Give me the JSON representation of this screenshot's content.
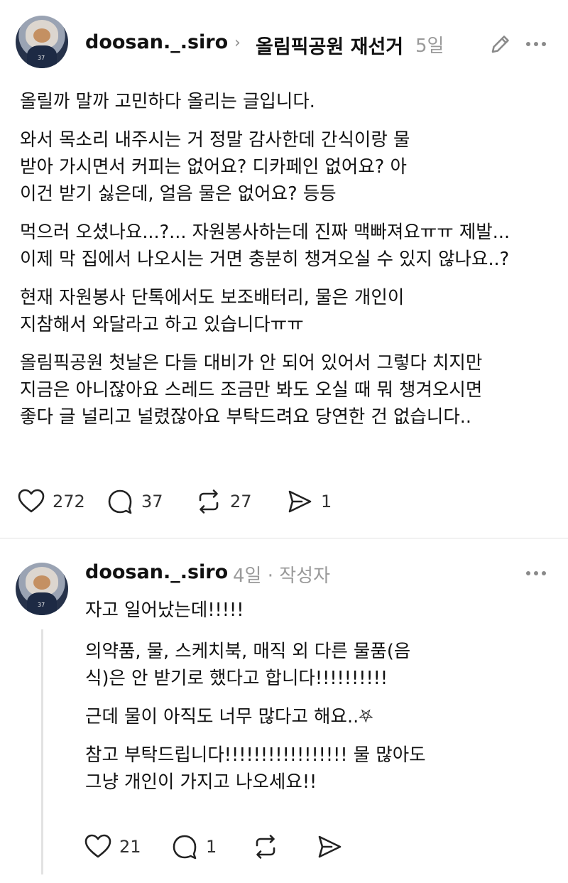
{
  "post": {
    "username": "doosan._.siro",
    "topic": "올림픽공원 재선거",
    "time": "5일",
    "paragraphs": [
      [
        "올릴까 말까 고민하다 올리는 글입니다."
      ],
      [
        "와서 목소리 내주시는 거 정말 감사한데 간식이랑 물",
        "받아 가시면서 커피는 없어요? 디카페인 없어요? 아",
        "이건 받기 싫은데, 얼음 물은 없어요? 등등"
      ],
      [
        "먹으러 오셨나요...?... 자원봉사하는데 진짜 맥빠져요ㅠㅠ 제발...",
        "이제 막 집에서 나오시는 거면 충분히 챙겨오실 수 있지 않나요..?"
      ],
      [
        "현재 자원봉사 단톡에서도 보조배터리, 물은 개인이",
        "지참해서 와달라고 하고 있습니다ㅠㅠ"
      ],
      [
        "올림픽공원 첫날은 다들 대비가 안 되어 있어서 그렇다 치지만",
        "지금은 아니잖아요 스레드 조금만 봐도 오실 때 뭐 챙겨오시면",
        "좋다 글 널리고 널렸잖아요 부탁드려요 당연한 건 없습니다.."
      ]
    ],
    "likes": "272",
    "replies": "37",
    "reposts": "27",
    "shares": "1"
  },
  "reply": {
    "username": "doosan._.siro",
    "time": "4일",
    "separator": "·",
    "author_tag": "작성자",
    "first_line": "자고 일어났는데!!!!!",
    "paragraphs": [
      [
        "의약품, 물, 스케치북, 매직 외 다른 물품(음",
        "식)은 안 받기로 했다고 합니다!!!!!!!!!!"
      ],
      [
        "근데 물이 아직도 너무 많다고 해요..⛧"
      ],
      [
        "참고 부탁드립니다!!!!!!!!!!!!!!!!! 물 많아도",
        "그냥 개인이 가지고 나오세요!!"
      ]
    ],
    "likes": "21",
    "replies": "1"
  },
  "icons": {
    "edit": "pencil-icon",
    "more": "more-icon",
    "like": "heart-icon",
    "reply": "comment-icon",
    "repost": "repost-icon",
    "share": "send-icon"
  }
}
